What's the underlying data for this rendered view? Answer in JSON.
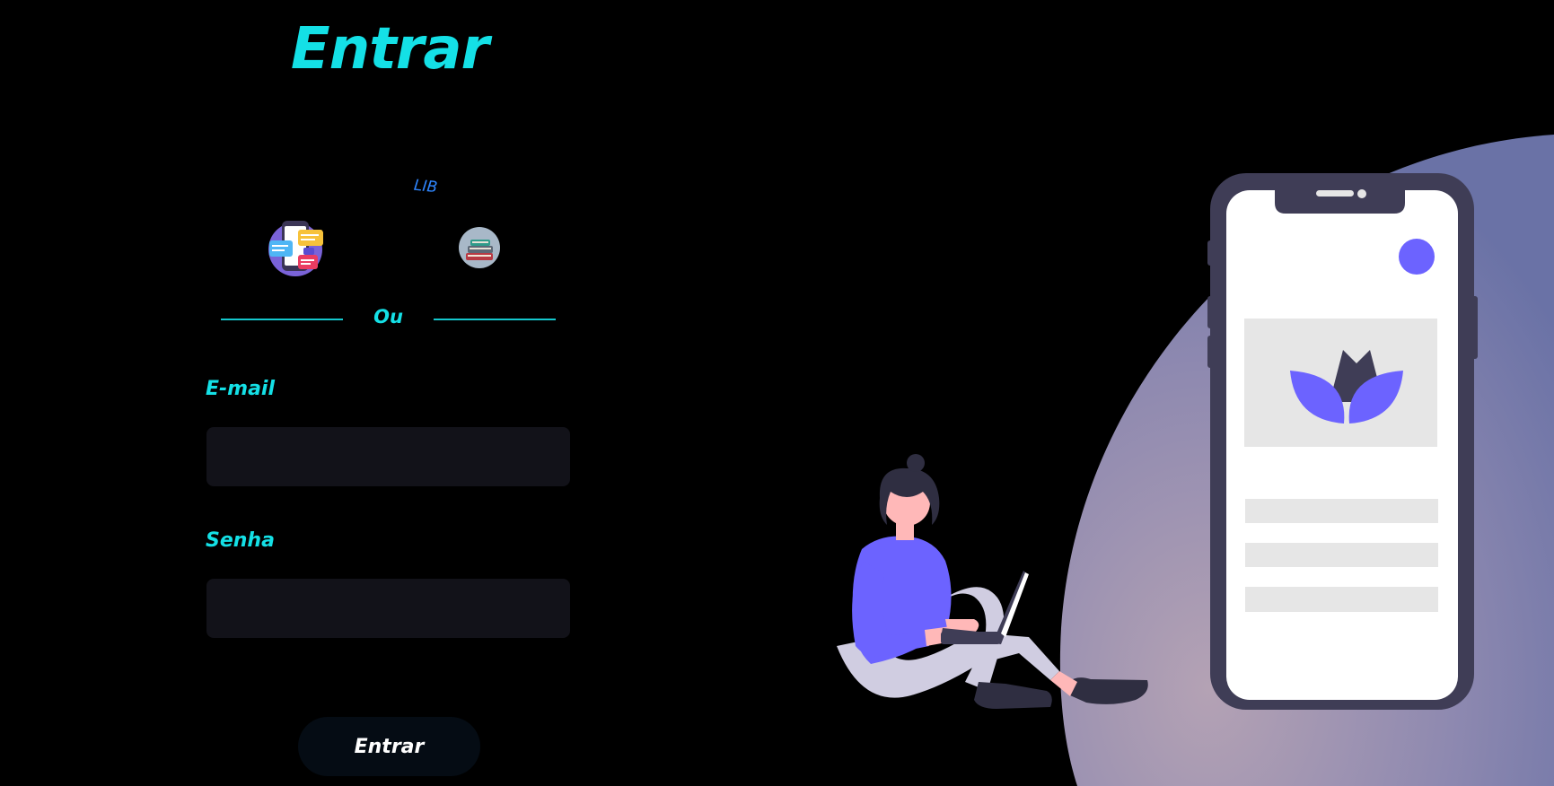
{
  "page": {
    "title": "Entrar"
  },
  "social": {
    "lib_label": "LIB",
    "chat_icon": "chat-app-icon",
    "books_icon": "books-icon"
  },
  "divider": {
    "text": "Ou"
  },
  "form": {
    "email_label": "E-mail",
    "email_value": "",
    "senha_label": "Senha",
    "senha_value": "",
    "submit_label": "Entrar"
  },
  "colors": {
    "accent": "#14e0e6",
    "background": "#000000",
    "input_bg": "#121219",
    "button_bg": "#050c14",
    "lib_blue": "#2f86ff",
    "illustration_purple": "#6c63ff"
  }
}
